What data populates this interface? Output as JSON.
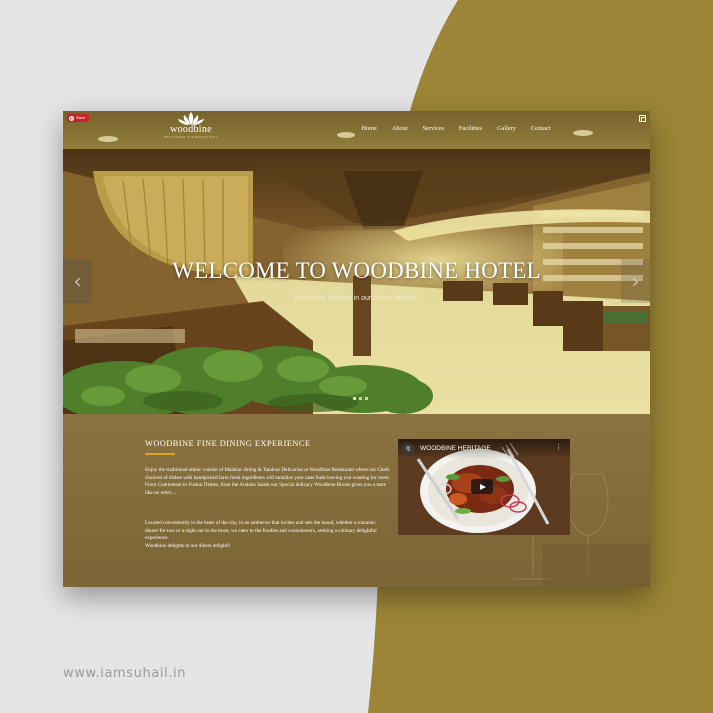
{
  "pin_button": {
    "label": "Save",
    "icon": "pinterest-icon"
  },
  "logo": {
    "name": "woodbine",
    "tagline": "RESTAURANT & BANQUET HALL"
  },
  "nav": {
    "items": [
      "Home",
      "About",
      "Services",
      "Facilities",
      "Gallery",
      "Contact"
    ]
  },
  "hero": {
    "title": "WELCOME TO WOODBINE HOTEL",
    "subtitle": "Woodbine delights in our diners delight!!",
    "slides": 3,
    "active_slide": 1
  },
  "about": {
    "title": "WOODBINE FINE DINING EXPERIENCE",
    "paragraph1": "Enjoy the traditional ethnic cuisine of Malabar dining & Tandoor Delicacies at Woodbine Restaurant where our Chefs choicest of dishes with handpicked farm fresh ingredients will tantalize your taste buds leaving you wanting for more. From Continental to Fusion Dishes, from the Arabian Sands our Special delicacy Woodbine Broast gives you a taste like no other.....",
    "paragraph2": "Located conveniently in the heart of the city, in an ambience that invites and sets the mood, whether a romantic dinner for two or a night out in the town, we cater to the foodies and connoisseurs, seeking a culinary delightful experience.",
    "paragraph3": "Woodbine delights in our diners delight!!"
  },
  "video": {
    "channel_initial": "q",
    "title": "WOODBINE HERITAGE",
    "menu_icon": "more-vert-icon"
  },
  "watermark": "www.iamsuhail.in",
  "colors": {
    "olive": "#9c8536",
    "panel": "#7d6637",
    "accent": "#d9a520",
    "background": "#e4e4e4"
  }
}
